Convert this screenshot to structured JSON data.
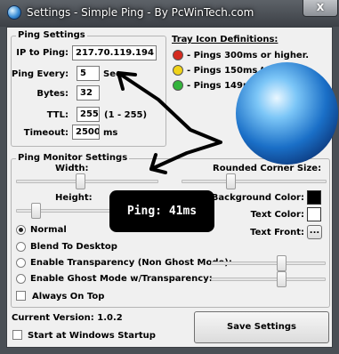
{
  "window": {
    "title": "Settings - Simple Ping - By PcWinTech.com",
    "close_label": "X"
  },
  "ping_settings": {
    "title": "Ping Settings",
    "ip_label": "IP to Ping:",
    "ip_value": "217.70.119.194",
    "ping_every_label": "Ping Every:",
    "ping_every_value": "5",
    "ping_every_unit": "Sec",
    "bytes_label": "Bytes:",
    "bytes_value": "32",
    "ttl_label": "TTL:",
    "ttl_value": "255",
    "ttl_range": "(1 - 255)",
    "timeout_label": "Timeout:",
    "timeout_value": "2500",
    "timeout_unit": "ms"
  },
  "tray": {
    "title": "Tray Icon Definitions:",
    "items": [
      {
        "label": "- Pings 300ms or higher.",
        "color": "#d42a1e"
      },
      {
        "label": "- Pings 150ms to 299ms.",
        "color": "#f0d31a"
      },
      {
        "label": "- Pings 149ms or lower.",
        "color": "#34b43c"
      }
    ]
  },
  "monitor": {
    "title": "Ping Monitor Settings",
    "width_label": "Width:",
    "height_label": "Height:",
    "corner_label": "Rounded Corner Size:",
    "bg_color_label": "Background Color:",
    "bg_color": "#000000",
    "text_color_label": "Text Color:",
    "text_color": "#ffffff",
    "text_font_label": "Text Front:",
    "font_button_label": "...",
    "mode_normal": "Normal",
    "mode_blend": "Blend To Desktop",
    "mode_transparency": "Enable Transparency (Non Ghost Mode):",
    "mode_ghost": "Enable Ghost Mode w/Transparency:",
    "always_on_top": "Always On Top",
    "selected_mode": "Normal"
  },
  "overlay": {
    "text": "Ping: 41ms"
  },
  "footer": {
    "version": "Current Version: 1.0.2",
    "startup_label": "Start at Windows Startup",
    "save_label": "Save Settings"
  }
}
